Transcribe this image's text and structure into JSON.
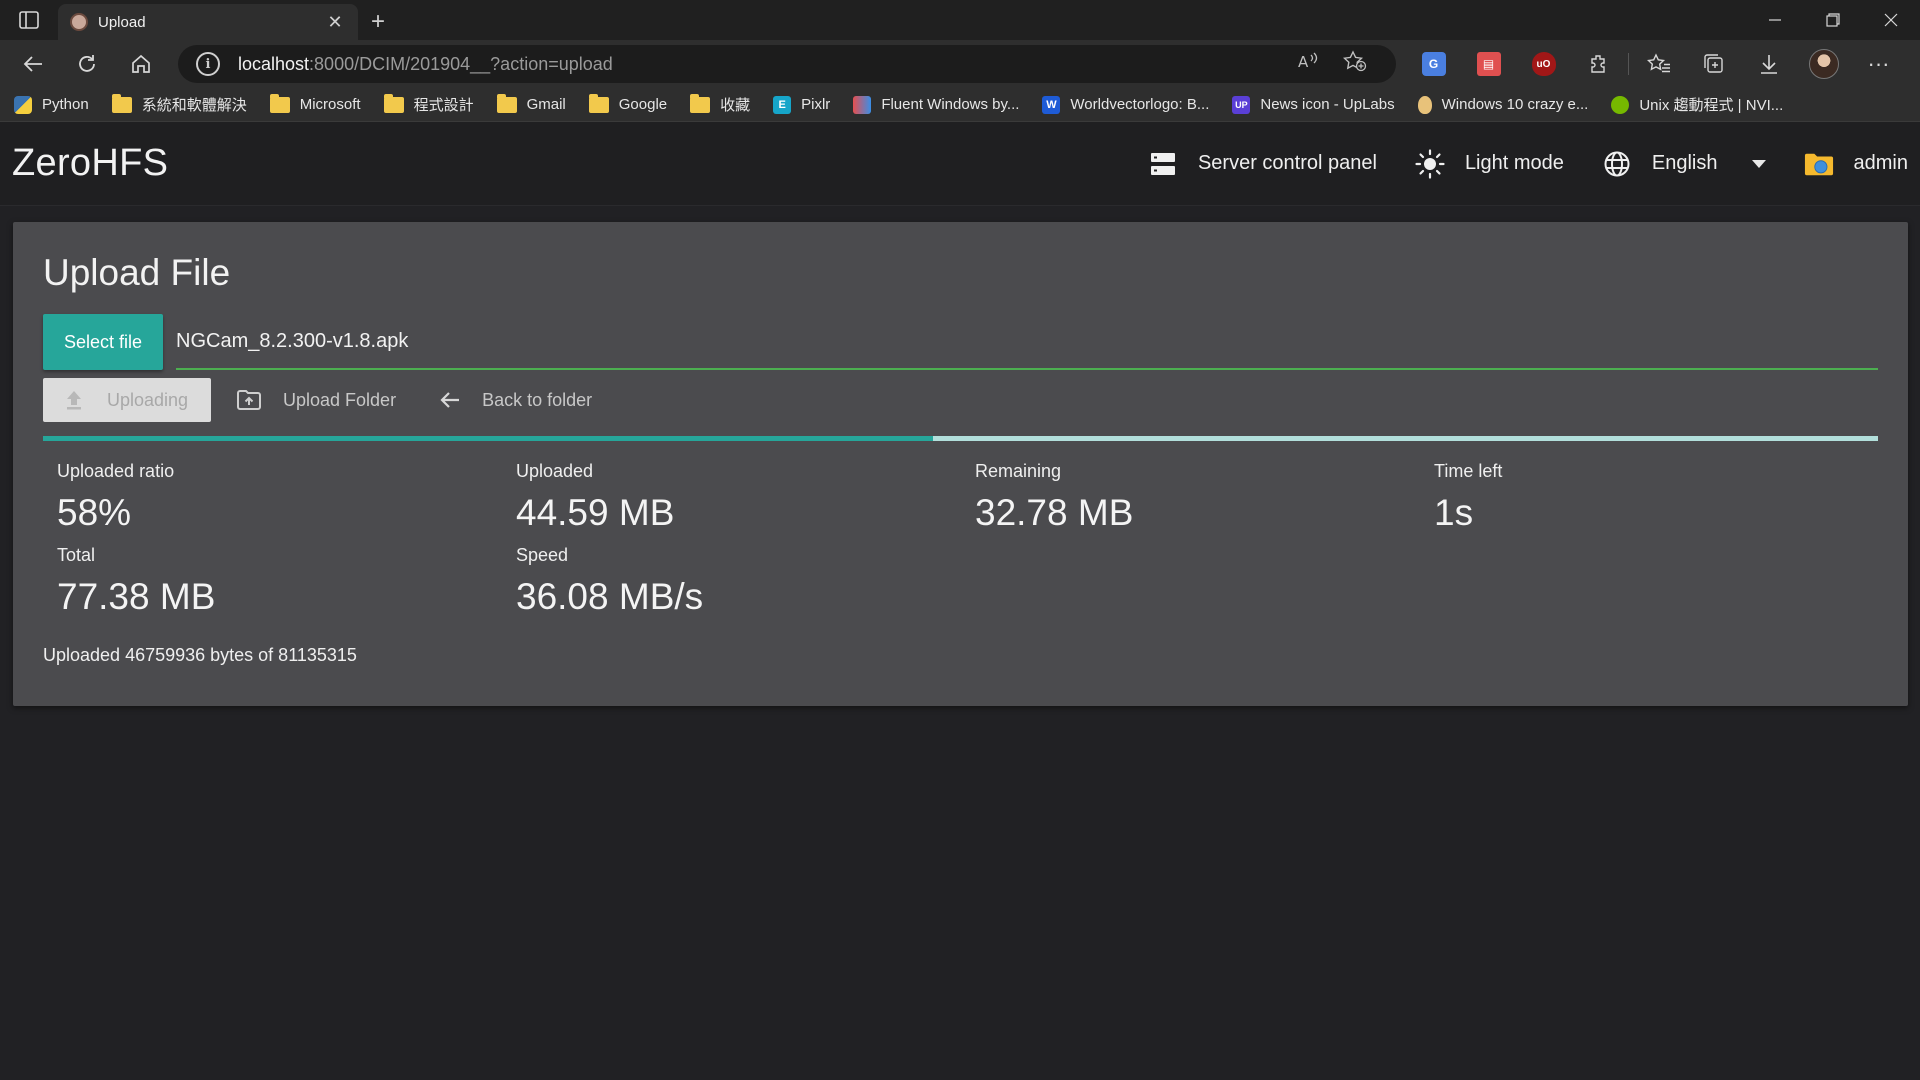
{
  "browser": {
    "tab_title": "Upload",
    "tab_close": "✕",
    "new_tab": "+",
    "url_host": "localhost",
    "url_path": ":8000/DCIM/201904__?action=upload",
    "bookmarks": [
      {
        "label": "Python",
        "icon": "python-icon"
      },
      {
        "label": "系統和軟體解決",
        "icon": "folder-icon"
      },
      {
        "label": "Microsoft",
        "icon": "folder-icon"
      },
      {
        "label": "程式設計",
        "icon": "folder-icon"
      },
      {
        "label": "Gmail",
        "icon": "folder-icon"
      },
      {
        "label": "Google",
        "icon": "folder-icon"
      },
      {
        "label": "收藏",
        "icon": "folder-icon"
      },
      {
        "label": "Pixlr",
        "icon": "pixlr-icon"
      },
      {
        "label": "Fluent Windows by...",
        "icon": "fluent-icon"
      },
      {
        "label": "Worldvectorlogo: B...",
        "icon": "worldvectorlogo-icon"
      },
      {
        "label": "News icon - UpLabs",
        "icon": "uplabs-icon"
      },
      {
        "label": "Windows 10 crazy e...",
        "icon": "egg-icon"
      },
      {
        "label": "Unix 趨動程式 | NVI...",
        "icon": "nvidia-icon"
      }
    ],
    "colors": {
      "titlebar": "#202020",
      "toolbar": "#2e2e2e"
    }
  },
  "app": {
    "brand": "ZeroHFS",
    "nav": {
      "server_control_panel": "Server control panel",
      "light_mode": "Light mode",
      "language": "English",
      "user": "admin"
    },
    "colors": {
      "accent": "#26a69a",
      "accent_light": "#b2dfdb",
      "input_underline": "#4caf50",
      "panel": "#4b4b4e"
    }
  },
  "upload": {
    "title": "Upload File",
    "select_file_label": "Select file",
    "file_name": "NGCam_8.2.300-v1.8.apk",
    "uploading_label": "Uploading",
    "upload_folder_label": "Upload Folder",
    "back_to_folder_label": "Back to folder",
    "progress_fraction": 0.485,
    "stats": {
      "uploaded_ratio_label": "Uploaded ratio",
      "uploaded_ratio_value": "58%",
      "uploaded_label": "Uploaded",
      "uploaded_value": "44.59 MB",
      "remaining_label": "Remaining",
      "remaining_value": "32.78 MB",
      "time_left_label": "Time left",
      "time_left_value": "1s",
      "total_label": "Total",
      "total_value": "77.38 MB",
      "speed_label": "Speed",
      "speed_value": "36.08 MB/s"
    },
    "summary": "Uploaded 46759936 bytes of 81135315"
  }
}
